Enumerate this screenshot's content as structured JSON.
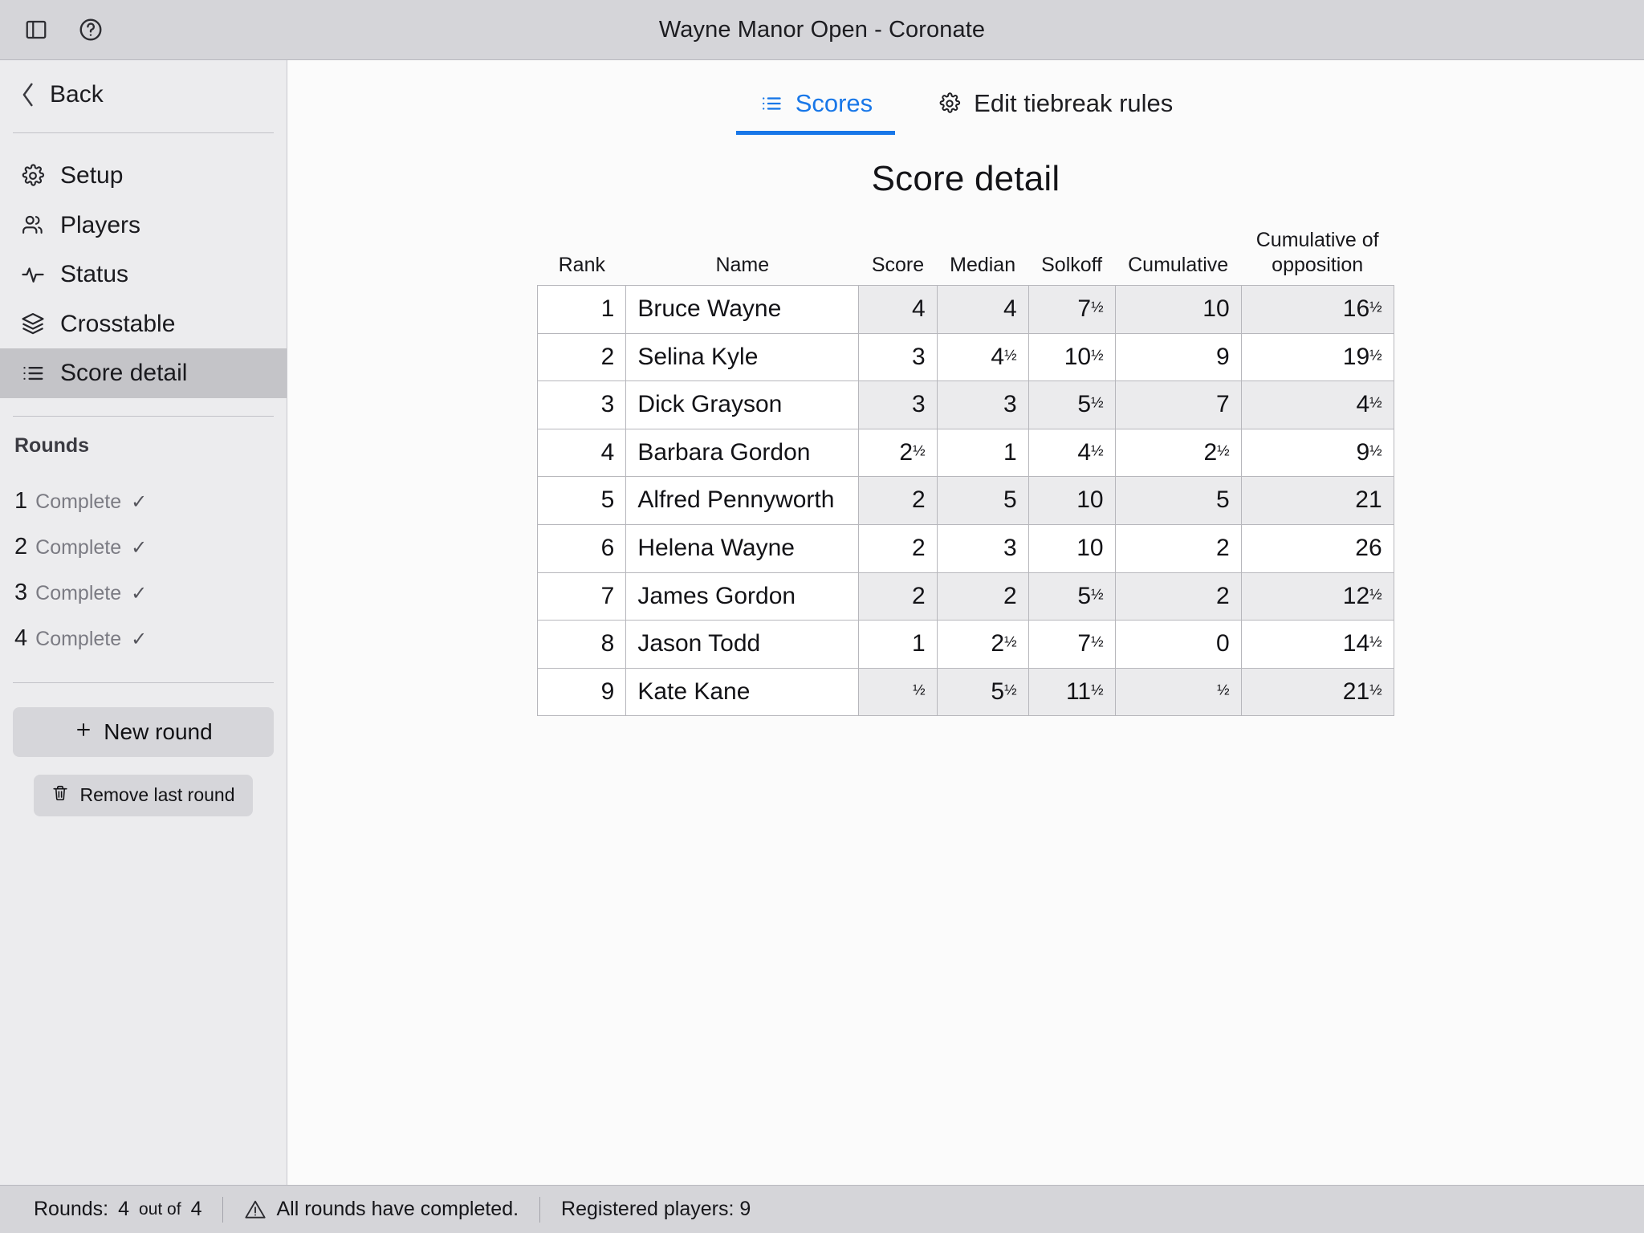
{
  "titlebar": {
    "title": "Wayne Manor Open - Coronate",
    "sidebar_toggle_icon": "sidebar-panel-icon",
    "help_icon": "help-circle-icon"
  },
  "sidebar": {
    "back_label": "Back",
    "nav_items": [
      {
        "label": "Setup",
        "icon": "gear-icon",
        "active": false
      },
      {
        "label": "Players",
        "icon": "users-icon",
        "active": false
      },
      {
        "label": "Status",
        "icon": "activity-pulse-icon",
        "active": false
      },
      {
        "label": "Crosstable",
        "icon": "layers-icon",
        "active": false
      },
      {
        "label": "Score detail",
        "icon": "list-icon",
        "active": true
      }
    ],
    "rounds_heading": "Rounds",
    "rounds": [
      {
        "number": "1",
        "status": "Complete",
        "check": "✓"
      },
      {
        "number": "2",
        "status": "Complete",
        "check": "✓"
      },
      {
        "number": "3",
        "status": "Complete",
        "check": "✓"
      },
      {
        "number": "4",
        "status": "Complete",
        "check": "✓"
      }
    ],
    "new_round_label": "New round",
    "new_round_icon": "plus-icon",
    "remove_round_label": "Remove last round",
    "remove_round_icon": "trash-icon"
  },
  "main": {
    "tabs": [
      {
        "label": "Scores",
        "icon": "list-icon",
        "active": true
      },
      {
        "label": "Edit tiebreak rules",
        "icon": "gear-icon",
        "active": false
      }
    ],
    "page_title": "Score detail",
    "accent_color": "#1877e8"
  },
  "table": {
    "columns": [
      "Rank",
      "Name",
      "Score",
      "Median",
      "Solkoff",
      "Cumulative",
      "Cumulative of opposition"
    ],
    "rows": [
      {
        "rank": "1",
        "name": "Bruce Wayne",
        "score": "4",
        "median": "4",
        "solkoff": "7½",
        "cumulative": "10",
        "cum_opp": "16½"
      },
      {
        "rank": "2",
        "name": "Selina Kyle",
        "score": "3",
        "median": "4½",
        "solkoff": "10½",
        "cumulative": "9",
        "cum_opp": "19½"
      },
      {
        "rank": "3",
        "name": "Dick Grayson",
        "score": "3",
        "median": "3",
        "solkoff": "5½",
        "cumulative": "7",
        "cum_opp": "4½"
      },
      {
        "rank": "4",
        "name": "Barbara Gordon",
        "score": "2½",
        "median": "1",
        "solkoff": "4½",
        "cumulative": "2½",
        "cum_opp": "9½"
      },
      {
        "rank": "5",
        "name": "Alfred Pennyworth",
        "score": "2",
        "median": "5",
        "solkoff": "10",
        "cumulative": "5",
        "cum_opp": "21"
      },
      {
        "rank": "6",
        "name": "Helena Wayne",
        "score": "2",
        "median": "3",
        "solkoff": "10",
        "cumulative": "2",
        "cum_opp": "26"
      },
      {
        "rank": "7",
        "name": "James Gordon",
        "score": "2",
        "median": "2",
        "solkoff": "5½",
        "cumulative": "2",
        "cum_opp": "12½"
      },
      {
        "rank": "8",
        "name": "Jason Todd",
        "score": "1",
        "median": "2½",
        "solkoff": "7½",
        "cumulative": "0",
        "cum_opp": "14½"
      },
      {
        "rank": "9",
        "name": "Kate Kane",
        "score": "½",
        "median": "5½",
        "solkoff": "11½",
        "cumulative": "½",
        "cum_opp": "21½"
      }
    ]
  },
  "statusbar": {
    "rounds_label": "Rounds:",
    "rounds_count": "4",
    "rounds_out_of": "out of",
    "rounds_total": "4",
    "warning_icon": "warning-triangle-icon",
    "warning_text": "All rounds have completed.",
    "players_text": "Registered players: 9"
  }
}
